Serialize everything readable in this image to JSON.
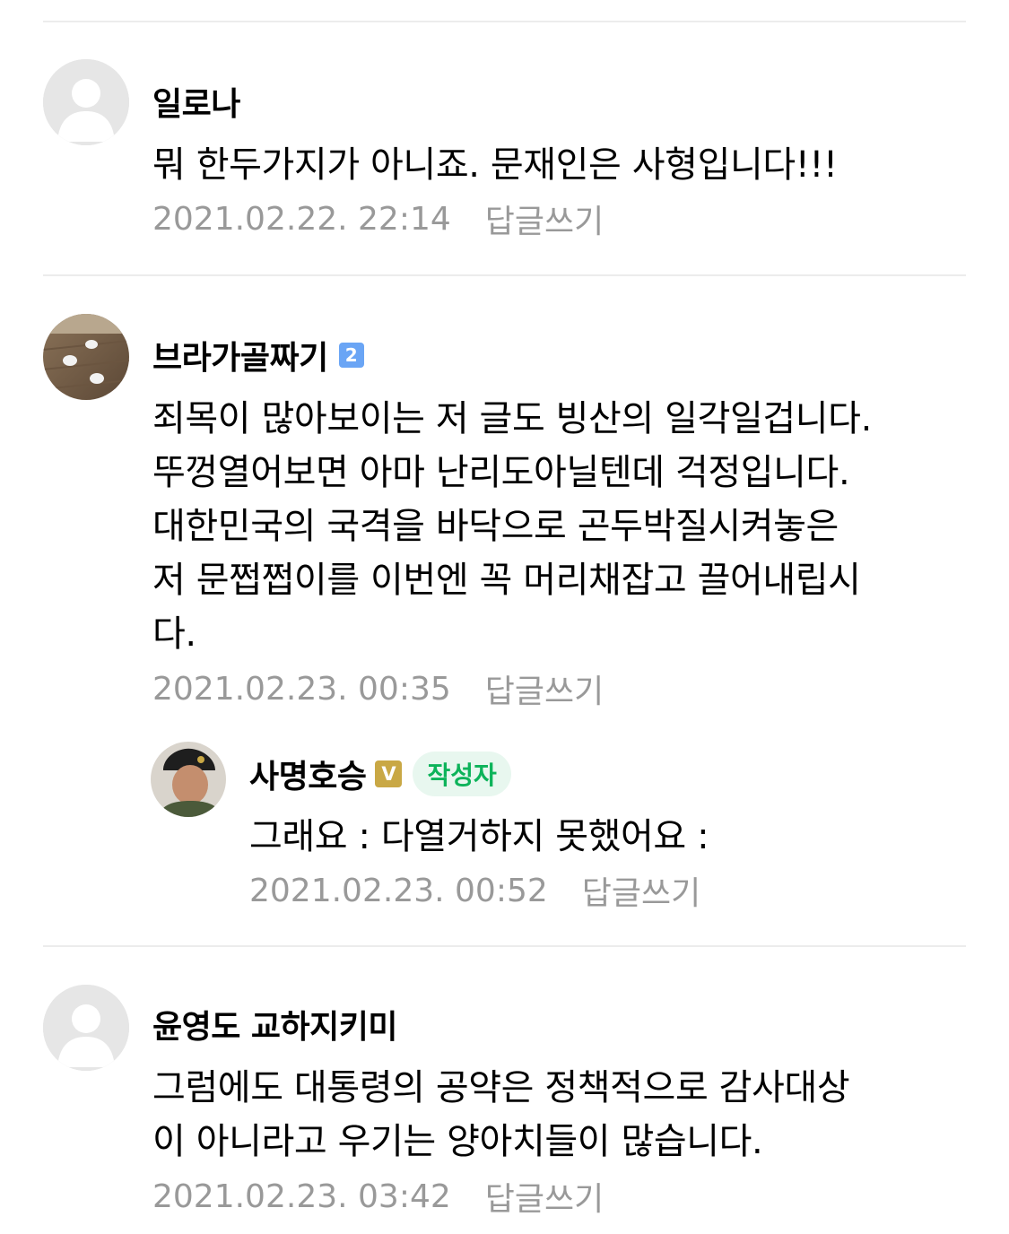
{
  "comments": [
    {
      "author": "일로나",
      "lines": [
        "뭐 한두가지가 아니죠. 문재인은 사형입니다!!!"
      ],
      "date": "2021.02.22. 22:14",
      "reply_label": "답글쓰기"
    },
    {
      "author": "브라가골짜기",
      "level_badge": "2",
      "lines": [
        "죄목이 많아보이는 저 글도 빙산의 일각일겁니다.",
        "뚜껑열어보면 아마 난리도아닐텐데 걱정입니다.",
        "대한민국의 국격을 바닥으로 곤두박질시켜놓은",
        "저 문쩝쩝이를 이번엔 꼭 머리채잡고 끌어내립시",
        "다."
      ],
      "date": "2021.02.23. 00:35",
      "reply_label": "답글쓰기"
    },
    {
      "author": "사명호승",
      "verified_badge": "V",
      "writer_badge": "작성자",
      "lines": [
        "그래요 : 다열거하지 못했어요 :"
      ],
      "date": "2021.02.23. 00:52",
      "reply_label": "답글쓰기"
    },
    {
      "author": "윤영도 교하지키미",
      "lines": [
        "그럼에도 대통령의 공약은 정책적으로 감사대상",
        "이 아니라고 우기는 양아치들이 많습니다."
      ],
      "date": "2021.02.23. 03:42",
      "reply_label": "답글쓰기"
    }
  ],
  "colors": {
    "divider": "#ececec",
    "meta": "#999999",
    "level_badge": "#6aa5f5",
    "verified_badge": "#c9a845",
    "writer_badge_bg": "#e8f7ef",
    "writer_badge_text": "#0db35a"
  }
}
